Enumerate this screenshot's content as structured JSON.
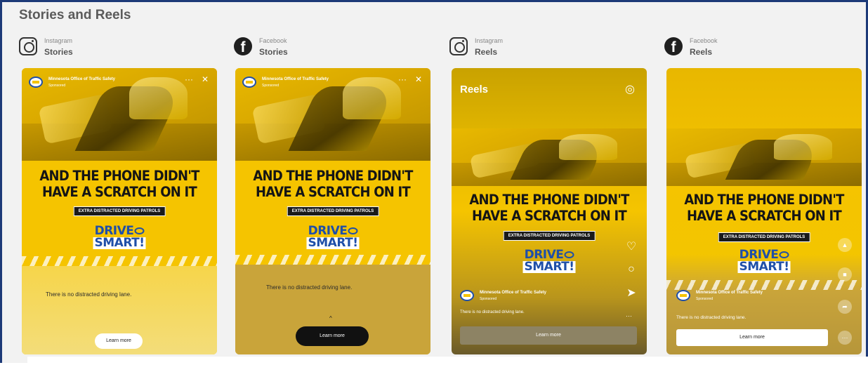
{
  "section": {
    "title": "Stories and Reels"
  },
  "ad": {
    "advertiser": "Minnesota Office of Traffic Safety",
    "sponsored": "Sponsored",
    "headline_line1": "AND THE PHONE DIDN'T",
    "headline_line2": "HAVE A SCRATCH ON IT",
    "patrol_text": "EXTRA DISTRACTED DRIVING PATROLS",
    "logo_line1": "DRIVE",
    "logo_line2": "SMART!",
    "caption": "There is no distracted driving lane.",
    "cta": "Learn more"
  },
  "placements": [
    {
      "platform": "Instagram",
      "format": "Stories",
      "icon": "instagram-icon"
    },
    {
      "platform": "Facebook",
      "format": "Stories",
      "icon": "facebook-icon"
    },
    {
      "platform": "Instagram",
      "format": "Reels",
      "icon": "instagram-icon",
      "overlay_title": "Reels"
    },
    {
      "platform": "Facebook",
      "format": "Reels",
      "icon": "facebook-icon"
    }
  ],
  "colors": {
    "brand_yellow": "#f5c400",
    "logo_blue": "#1f4fa8",
    "frame_border": "#1d3a78"
  }
}
